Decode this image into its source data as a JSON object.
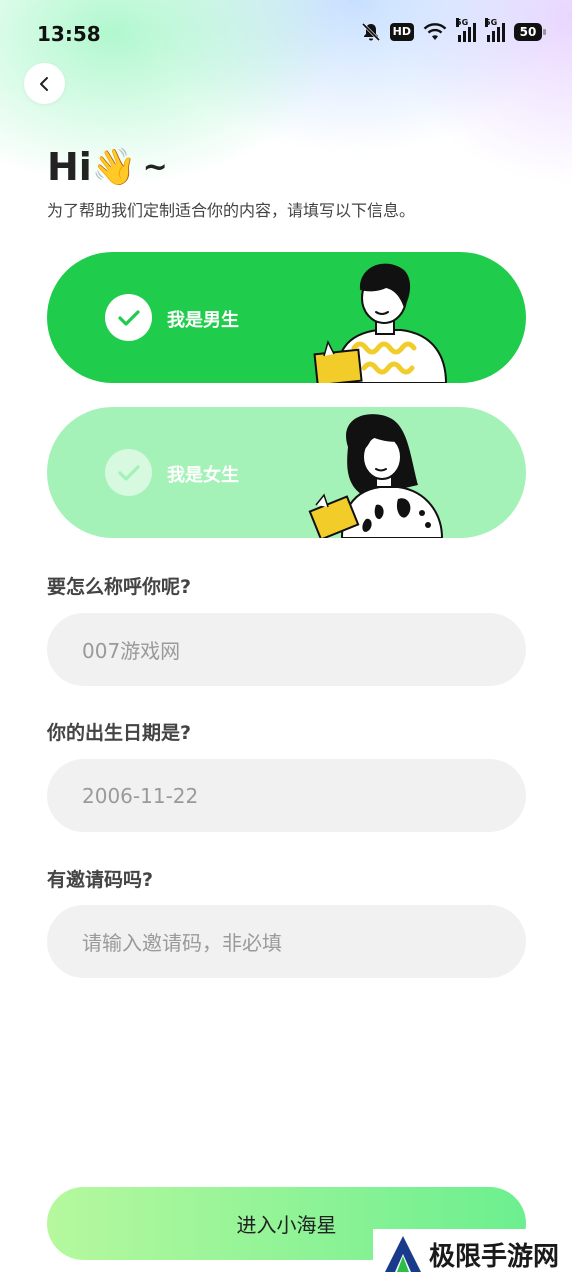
{
  "status_bar": {
    "time": "13:58",
    "hd_label": "HD",
    "signal_tag": "5G",
    "battery": "50"
  },
  "header": {
    "greeting": "Hi",
    "greeting_emoji": "👋",
    "greeting_tail": "~",
    "subtitle": "为了帮助我们定制适合你的内容，请填写以下信息。"
  },
  "gender_options": [
    {
      "label": "我是男生",
      "selected": true
    },
    {
      "label": "我是女生",
      "selected": false
    }
  ],
  "name_section": {
    "label": "要怎么称呼你呢?",
    "value": "007游戏网"
  },
  "birthday_section": {
    "label": "你的出生日期是?",
    "value": "2006-11-22"
  },
  "invite_section": {
    "label": "有邀请码吗?",
    "placeholder": "请输入邀请码，非必填"
  },
  "enter_button": {
    "label": "进入小海星"
  },
  "watermark": {
    "text": "极限手游网"
  },
  "colors": {
    "primary": "#1fcc4b",
    "light": "#a5f2b8",
    "field_bg": "#f1f1f1"
  }
}
